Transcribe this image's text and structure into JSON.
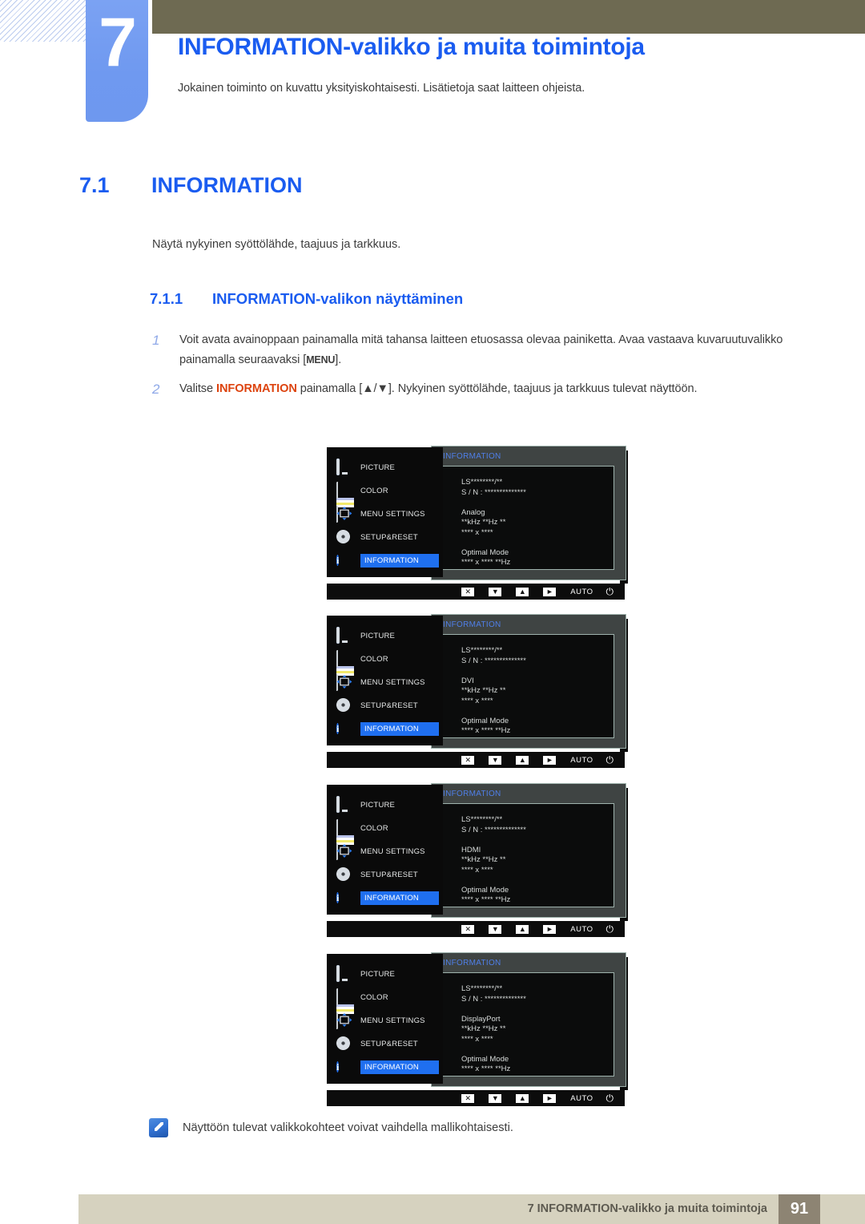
{
  "chapter": {
    "number": "7",
    "title": "INFORMATION-valikko ja muita toimintoja",
    "subtitle": "Jokainen toiminto on kuvattu yksityiskohtaisesti. Lisätietoja saat laitteen ohjeista."
  },
  "section": {
    "number": "7.1",
    "title": "INFORMATION",
    "description": "Näytä nykyinen syöttölähde, taajuus ja tarkkuus.",
    "sub_number": "7.1.1",
    "sub_title": "INFORMATION-valikon näyttäminen"
  },
  "steps": [
    {
      "marker": "1",
      "text_before": "Voit avata avainoppaan painamalla mitä tahansa laitteen etuosassa olevaa painiketta. Avaa vastaava kuvaruutuvalikko painamalla seuraavaksi [",
      "key": "MENU",
      "text_after": "]."
    },
    {
      "marker": "2",
      "text_before": "Valitse ",
      "highlight": "INFORMATION",
      "text_after": " painamalla [▲/▼]. Nykyinen syöttölähde, taajuus ja tarkkuus tulevat näyttöön."
    }
  ],
  "osd": {
    "menu_items": [
      {
        "icon": "monitor-icon",
        "label": "PICTURE",
        "active": false
      },
      {
        "icon": "color-bars-icon",
        "label": "COLOR",
        "active": false
      },
      {
        "icon": "menu-settings-icon",
        "label": "MENU SETTINGS",
        "active": false
      },
      {
        "icon": "gear-icon",
        "label": "SETUP&RESET",
        "active": false
      },
      {
        "icon": "info-icon",
        "label": "INFORMATION",
        "active": true
      }
    ],
    "panel_title": "INFORMATION",
    "model_line": "LS********/**",
    "serial_line": "S / N : **************",
    "freq_line": "**kHz **Hz **",
    "res_line": "**** x ****",
    "optimal_label": "Optimal Mode",
    "optimal_value": "**** x **** **Hz",
    "keybar": {
      "close": "✕",
      "down": "▼",
      "up": "▲",
      "right": "►",
      "auto": "AUTO",
      "power": "⏻"
    },
    "screens": [
      {
        "source": "Analog"
      },
      {
        "source": "DVI"
      },
      {
        "source": "HDMI"
      },
      {
        "source": "DisplayPort"
      }
    ]
  },
  "note": {
    "text": "Näyttöön tulevat valikkokohteet voivat vaihdella mallikohtaisesti."
  },
  "footer": {
    "text": "7 INFORMATION-valikko ja muita toimintoja",
    "page": "91"
  },
  "colors": {
    "accent_blue": "#1a5cf0",
    "olive": "#6e6a52",
    "tab_blue": "#7ba2f3",
    "orange": "#dd4410",
    "footer_band": "#d6d2bf",
    "footer_page": "#8d8473"
  }
}
